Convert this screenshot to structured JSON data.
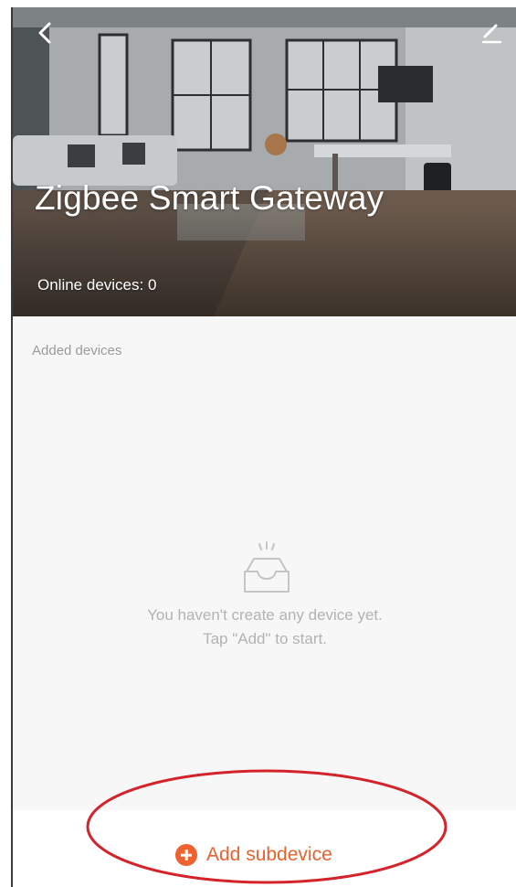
{
  "header": {
    "title": "Zigbee Smart Gateway",
    "online_devices": "Online devices: 0",
    "back_icon": "chevron-left-icon",
    "edit_icon": "pencil-icon"
  },
  "main": {
    "section_label": "Added devices",
    "empty_state": {
      "icon": "empty-inbox-icon",
      "line1": "You haven't create any device yet.",
      "line2": "Tap \"Add\" to start."
    }
  },
  "footer": {
    "add_button_label": "Add subdevice",
    "add_icon": "plus-circle-icon"
  },
  "colors": {
    "accent": "#f0622d",
    "annotation": "#d4232a",
    "muted_text": "#b3b3b3"
  }
}
